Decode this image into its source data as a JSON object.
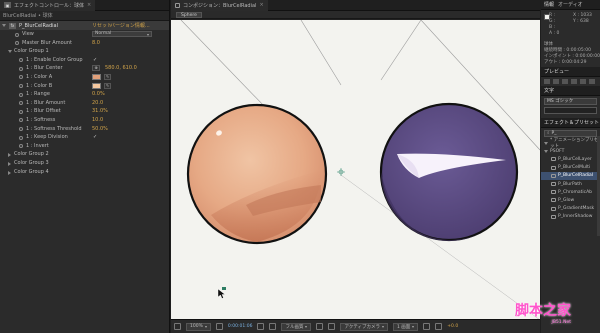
{
  "effect_controls": {
    "tab_label": "エフェクトコントロール：球体",
    "comp_path": "BlurCelRadial • 球体",
    "layer_name": "P_BlurCelRadial",
    "reset_label": "リセット",
    "about_label": "バージョン情報...",
    "params": [
      {
        "label": "View",
        "kind": "dropdown",
        "value": "Normal",
        "indent": 1
      },
      {
        "label": "Master Blur Amount",
        "kind": "value",
        "value": "8.0",
        "indent": 1
      },
      {
        "label": "Color Group 1",
        "kind": "group-open",
        "indent": 1
      },
      {
        "label": "1 : Enable Color Group",
        "kind": "check",
        "value": "✓",
        "indent": 2
      },
      {
        "label": "1 : Blur Center",
        "kind": "point",
        "value": "580.0, 610.0",
        "indent": 2
      },
      {
        "label": "1 : Color A",
        "kind": "color",
        "color": "#e2a07a",
        "indent": 2
      },
      {
        "label": "1 : Color B",
        "kind": "color",
        "color": "#f5c8a0",
        "indent": 2
      },
      {
        "label": "1 : Range",
        "kind": "value",
        "value": "0.0%",
        "indent": 2
      },
      {
        "label": "1 : Blur Amount",
        "kind": "value",
        "value": "20.0",
        "indent": 2
      },
      {
        "label": "1 : Blur Offset",
        "kind": "value",
        "value": "31.0%",
        "indent": 2
      },
      {
        "label": "1 : Softness",
        "kind": "value",
        "value": "10.0",
        "indent": 2
      },
      {
        "label": "1 : Softness Threshold",
        "kind": "value",
        "value": "50.0%",
        "indent": 2
      },
      {
        "label": "1 : Keep Division",
        "kind": "check",
        "value": "✓",
        "indent": 2
      },
      {
        "label": "1 : Invert",
        "kind": "check",
        "value": "",
        "indent": 2
      },
      {
        "label": "Color Group 2",
        "kind": "group",
        "indent": 1
      },
      {
        "label": "Color Group 3",
        "kind": "group",
        "indent": 1
      },
      {
        "label": "Color Group 4",
        "kind": "group",
        "indent": 1
      }
    ]
  },
  "composition": {
    "tab_label": "コンポジション：BlurCelRadial",
    "breadcrumb": "Sphere",
    "footer": {
      "zoom": "100%",
      "timecode": "0:00:01:06",
      "resolution": "フル画質",
      "camera": "アクティブカメラ",
      "views": "1 画面",
      "offset": "+0.0"
    }
  },
  "info_panel": {
    "tabs": [
      "情報",
      "オーディオ"
    ],
    "r_label": "R :",
    "g_label": "G :",
    "b_label": "B :",
    "a_label": "A : 0",
    "x_label": "X : 1033",
    "y_label": "Y : 638",
    "layer_name": "球体",
    "duration_line": "継続時間 : 0:00:05:00",
    "in_line": "インポイント : 0:00:00:00",
    "out_line": "アウト : 0:00:04:29"
  },
  "preview_panel": {
    "tab_label": "プレビュー"
  },
  "character_panel": {
    "tab_label": "文字",
    "font": "MS ゴシック"
  },
  "effects_panel": {
    "tab_label": "エフェクト＆プリセット",
    "search_value": "P_",
    "category": "* アニメーションプリセット",
    "group": "PSOFT",
    "items": [
      "P_BlurCelLayer",
      "P_BlurCelMulti",
      "P_BlurCelRadial",
      "P_BlurPath",
      "P_ChromaticAb",
      "P_Glow",
      "P_GradientMask",
      "P_InnerShadow"
    ],
    "selected_index": 2
  },
  "watermark": {
    "text": "脚本之家",
    "sub": "JB51.Net"
  },
  "colors": {
    "sphere_left": "#eab08f",
    "sphere_right": "#5b4b82",
    "canvas": "#f3f3ef",
    "param_value": "#d2a44a",
    "selection": "#3d5170"
  }
}
